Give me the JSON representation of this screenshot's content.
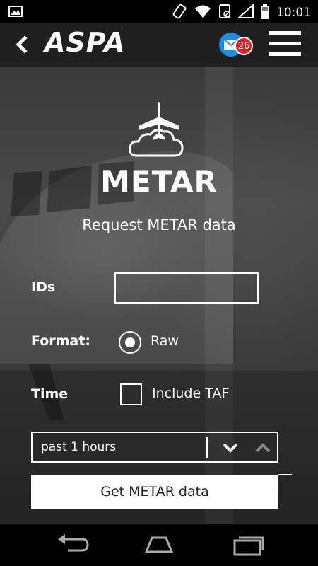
{
  "status_bar": {
    "time": "10:01",
    "icons": [
      "image-icon",
      "screen-rotation-icon",
      "wifi-icon",
      "sync-disabled-icon",
      "signal-icon",
      "battery-icon"
    ]
  },
  "app_bar": {
    "logo": "ASPA",
    "mail_badge_count": "26",
    "icons": [
      "back-chevron-icon",
      "mail-icon",
      "hamburger-menu-icon"
    ],
    "mail_color": "#1e8de0",
    "badge_color": "#e32028"
  },
  "page": {
    "hero_icon": "airplane-cloud-icon",
    "title": "METAR",
    "subtitle": "Request METAR data"
  },
  "form": {
    "ids_label": "IDs",
    "ids_value": "",
    "format_label": "Format:",
    "format_option": "Raw",
    "format_selected": true,
    "time_label": "Time",
    "include_taf_label": "Include TAF",
    "include_taf_checked": false,
    "hours_selected": "past 1 hours",
    "submit_label": "Get METAR data"
  },
  "nav_bar": {
    "icons": [
      "back-nav-icon",
      "home-nav-icon",
      "recents-nav-icon"
    ]
  }
}
